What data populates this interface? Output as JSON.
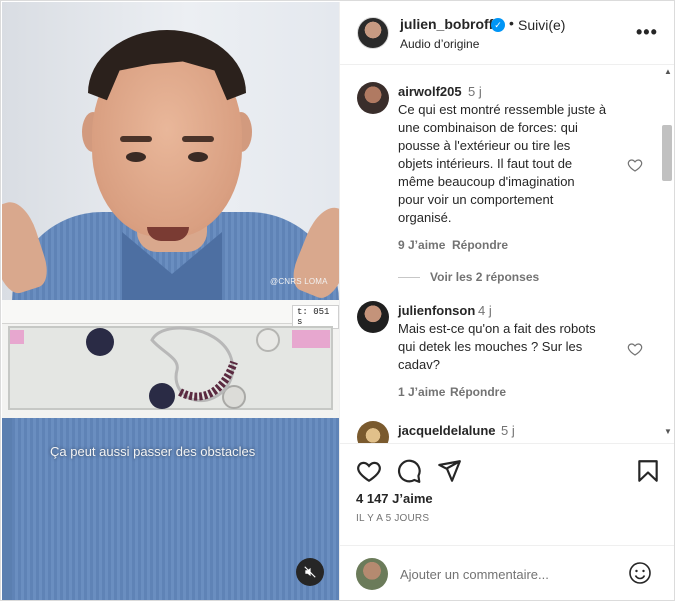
{
  "header": {
    "username": "julien_bobroff",
    "verified_symbol": "✓",
    "separator": "•",
    "follow_status": "Suivi(e)",
    "subtitle": "Audio d’origine",
    "more_symbol": "•••"
  },
  "media": {
    "watermark": "@CNRS LOMA",
    "timer": "t: 051  s",
    "caption": "Ça peut aussi passer des obstacles"
  },
  "comments": [
    {
      "username": "airwolf205",
      "time": "5 j",
      "lines": [
        "Ce qui est montré ressemble juste à",
        "une combinaison de forces: qui",
        "pousse à l'extérieur ou tire les",
        "objets intérieurs. Il faut tout de",
        "même beaucoup d'imagination",
        "pour voir un comportement",
        "organisé."
      ],
      "likes": "9 J’aime",
      "reply": "Répondre"
    },
    {
      "username": "julienfonson",
      "time": "4 j",
      "lines": [
        "Mais est-ce qu'on a fait des robots",
        "qui detek les mouches ? Sur les",
        "cadav?"
      ],
      "likes": "1 J’aime",
      "reply": "Répondre"
    },
    {
      "username": "jacqueldelalune",
      "time": "5 j"
    }
  ],
  "view_replies": "Voir les 2 réponses",
  "likes_total": "4 147 J’aime",
  "posted_ago": "IL Y A 5 JOURS",
  "composer": {
    "placeholder": "Ajouter un commentaire..."
  },
  "colors": {
    "accent": "#0095f6",
    "text": "#262626",
    "muted": "#737373"
  }
}
